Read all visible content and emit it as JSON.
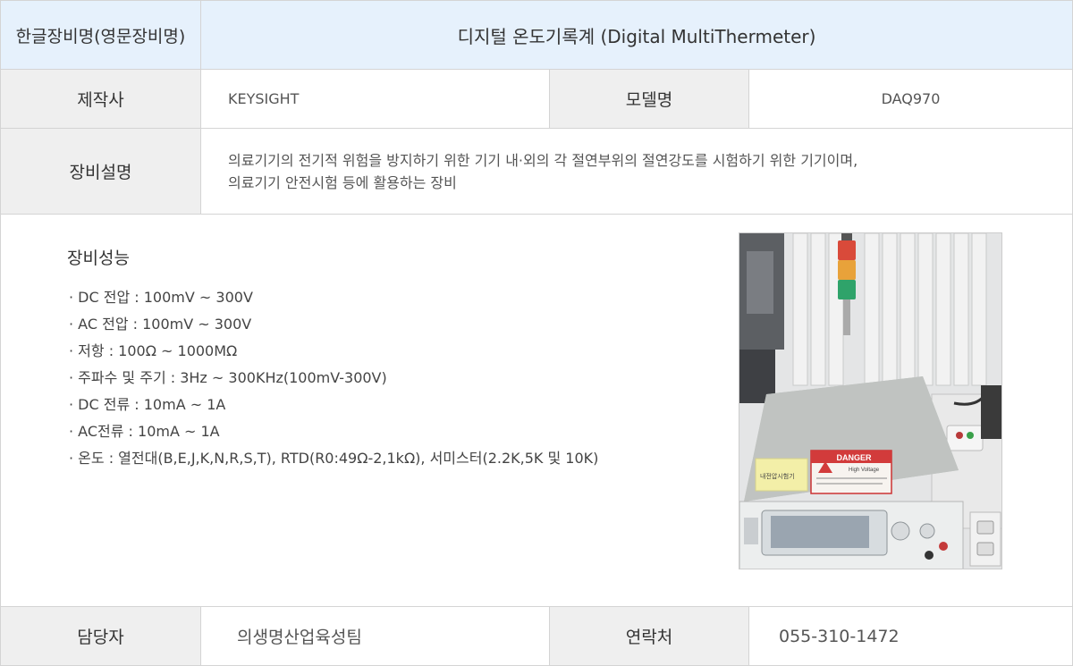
{
  "header": {
    "label": "한글장비명(영문장비명)",
    "title": "디지털 온도기록계 (Digital MultiThermeter)"
  },
  "maker": {
    "label": "제작사",
    "value": "KEYSIGHT"
  },
  "model": {
    "label": "모델명",
    "value": "DAQ970"
  },
  "description": {
    "label": "장비설명",
    "lines": [
      "의료기기의 전기적 위험을 방지하기 위한 기기 내·외의 각 절연부위의 절연강도를 시험하기 위한 기기이며,",
      "의료기기 안전시험 등에 활용하는 장비"
    ]
  },
  "performance": {
    "title": "장비성능",
    "items": [
      "· DC 전압 : 100mV ~ 300V",
      "· AC 전압 : 100mV ~ 300V",
      "· 저항  : 100Ω ~ 1000MΩ",
      "· 주파수 및 주기 : 3Hz ~ 300KHz(100mV-300V)",
      "· DC 전류 : 10mA ~ 1A",
      "· AC전류 : 10mA ~ 1A",
      "· 온도 : 열전대(B,E,J,K,N,R,S,T), RTD(R0:49Ω-2,1kΩ), 서미스터(2.2K,5K 및 10K)"
    ]
  },
  "photo": {
    "danger_label": "DANGER",
    "danger_sub": "High Voltage",
    "sticker_text": "내전압시험기"
  },
  "manager": {
    "label": "담당자",
    "value": "의생명산업육성팀"
  },
  "contact": {
    "label": "연락처",
    "value": "055-310-1472"
  }
}
